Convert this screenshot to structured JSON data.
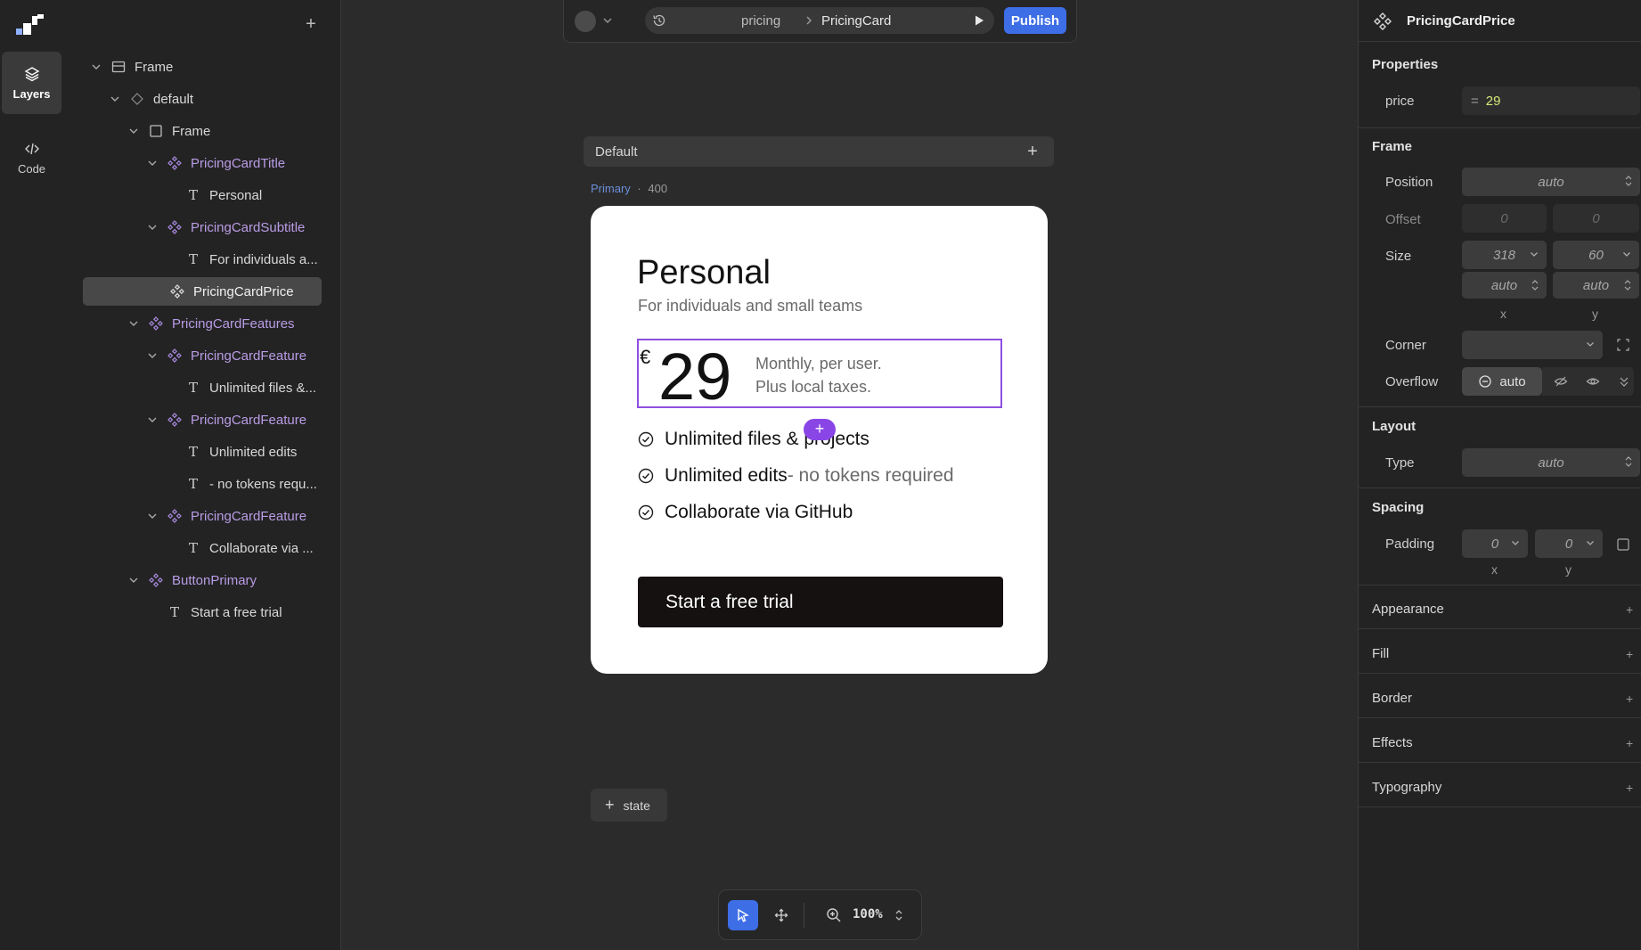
{
  "rail": {
    "items": [
      {
        "label": "Layers",
        "icon": "layers-icon",
        "active": true
      },
      {
        "label": "Code",
        "icon": "code-icon",
        "active": false
      }
    ]
  },
  "layers": {
    "add_icon": "plus-icon",
    "tree": [
      {
        "label": "Frame",
        "type": "frame",
        "depth": 0,
        "expanded": true
      },
      {
        "label": "default",
        "type": "variant",
        "depth": 1,
        "expanded": true
      },
      {
        "label": "Frame",
        "type": "frame",
        "depth": 2,
        "expanded": true
      },
      {
        "label": "PricingCardTitle",
        "type": "component",
        "depth": 3,
        "expanded": true
      },
      {
        "label": "Personal",
        "type": "text",
        "depth": 4
      },
      {
        "label": "PricingCardSubtitle",
        "type": "component",
        "depth": 3,
        "expanded": true
      },
      {
        "label": "For individuals a...",
        "type": "text",
        "depth": 4
      },
      {
        "label": "PricingCardPrice",
        "type": "component",
        "depth": 2,
        "selected": true
      },
      {
        "label": "PricingCardFeatures",
        "type": "component",
        "depth": 2,
        "expanded": true
      },
      {
        "label": "PricingCardFeature",
        "type": "component",
        "depth": 3,
        "expanded": true
      },
      {
        "label": "Unlimited files &...",
        "type": "text",
        "depth": 4
      },
      {
        "label": "PricingCardFeature",
        "type": "component",
        "depth": 3,
        "expanded": true
      },
      {
        "label": "Unlimited edits",
        "type": "text",
        "depth": 4
      },
      {
        "label": "- no tokens requ...",
        "type": "text",
        "depth": 4
      },
      {
        "label": "PricingCardFeature",
        "type": "component",
        "depth": 3,
        "expanded": true
      },
      {
        "label": "Collaborate via ...",
        "type": "text",
        "depth": 4
      },
      {
        "label": "ButtonPrimary",
        "type": "component",
        "depth": 2,
        "expanded": true
      },
      {
        "label": "Start a free trial",
        "type": "text",
        "depth": 3
      }
    ]
  },
  "topbar": {
    "breadcrumb": [
      "pricing",
      "PricingCard"
    ],
    "publish_label": "Publish"
  },
  "canvas": {
    "variant_label": "Default",
    "meta_primary": "Primary",
    "meta_dot": "·",
    "meta_width": "400",
    "add_state_label": "state"
  },
  "card": {
    "title": "Personal",
    "subtitle": "For individuals and small teams",
    "currency": "€",
    "price": "29",
    "price_note_1": "Monthly, per user.",
    "price_note_2": "Plus local taxes.",
    "features": [
      {
        "text": "Unlimited files & projects",
        "muted": ""
      },
      {
        "text": "Unlimited edits",
        "muted": "- no tokens required"
      },
      {
        "text": "Collaborate via GitHub",
        "muted": ""
      }
    ],
    "cta": "Start a free trial"
  },
  "toolbar": {
    "zoom": "100%"
  },
  "props": {
    "component_name": "PricingCardPrice",
    "properties_title": "Properties",
    "price_label": "price",
    "price_eq": "=",
    "price_value": "29",
    "frame_title": "Frame",
    "position_label": "Position",
    "position_value": "auto",
    "offset_label": "Offset",
    "offset_x": "0",
    "offset_y": "0",
    "size_label": "Size",
    "size_w": "318",
    "size_h": "60",
    "size_min_w": "auto",
    "size_min_h": "auto",
    "axis_x": "x",
    "axis_y": "y",
    "corner_label": "Corner",
    "overflow_label": "Overflow",
    "overflow_value": "auto",
    "layout_title": "Layout",
    "type_label": "Type",
    "type_value": "auto",
    "spacing_title": "Spacing",
    "padding_label": "Padding",
    "padding_x": "0",
    "padding_y": "0",
    "collapsed_sections": [
      "Appearance",
      "Fill",
      "Border",
      "Effects",
      "Typography"
    ]
  },
  "colors": {
    "accent": "#3d6ee6",
    "selection": "#8e4fe0",
    "component": "#b99ce6",
    "price_value": "#d6e87a"
  }
}
